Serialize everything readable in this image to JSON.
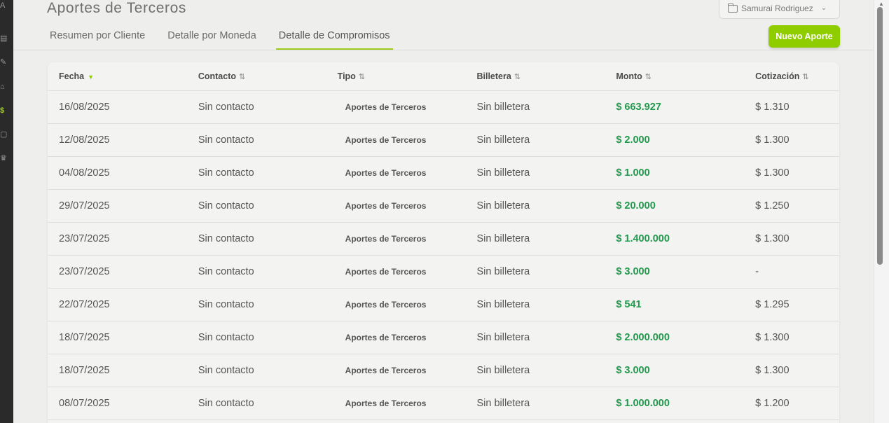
{
  "app": {
    "page_title": "Aportes de Terceros",
    "workspace_label": "Samurai Rodriguez",
    "new_button_label": "Nuevo Aporte",
    "accent_color": "#8fcc00",
    "amount_color": "#1f9a4c"
  },
  "rail": {
    "items": [
      {
        "icon": "logo-icon",
        "glyph": "A"
      },
      {
        "icon": "building-icon",
        "glyph": "▤"
      },
      {
        "icon": "pencil-icon",
        "glyph": "✎"
      },
      {
        "icon": "bell-icon",
        "glyph": "⌂"
      },
      {
        "icon": "dollar-icon",
        "glyph": "$"
      },
      {
        "icon": "card-icon",
        "glyph": "▢"
      },
      {
        "icon": "crown-icon",
        "glyph": "♛"
      }
    ]
  },
  "tabs": [
    {
      "label": "Resumen por Cliente",
      "active": false
    },
    {
      "label": "Detalle por Moneda",
      "active": false
    },
    {
      "label": "Detalle de Compromisos",
      "active": true
    }
  ],
  "table": {
    "columns": [
      {
        "label": "Fecha",
        "sort": "desc"
      },
      {
        "label": "Contacto",
        "sort": "both"
      },
      {
        "label": "Tipo",
        "sort": "both"
      },
      {
        "label": "Billetera",
        "sort": "both"
      },
      {
        "label": "Monto",
        "sort": "both"
      },
      {
        "label": "Cotización",
        "sort": "both"
      }
    ],
    "rows": [
      [
        "16/08/2025",
        "Sin contacto",
        "Aportes de Terceros",
        "Sin billetera",
        "$ 663.927",
        "$ 1.310"
      ],
      [
        "12/08/2025",
        "Sin contacto",
        "Aportes de Terceros",
        "Sin billetera",
        "$ 2.000",
        "$ 1.300"
      ],
      [
        "04/08/2025",
        "Sin contacto",
        "Aportes de Terceros",
        "Sin billetera",
        "$ 1.000",
        "$ 1.300"
      ],
      [
        "29/07/2025",
        "Sin contacto",
        "Aportes de Terceros",
        "Sin billetera",
        "$ 20.000",
        "$ 1.250"
      ],
      [
        "23/07/2025",
        "Sin contacto",
        "Aportes de Terceros",
        "Sin billetera",
        "$ 1.400.000",
        "$ 1.300"
      ],
      [
        "23/07/2025",
        "Sin contacto",
        "Aportes de Terceros",
        "Sin billetera",
        "$ 3.000",
        "-"
      ],
      [
        "22/07/2025",
        "Sin contacto",
        "Aportes de Terceros",
        "Sin billetera",
        "$ 541",
        "$ 1.295"
      ],
      [
        "18/07/2025",
        "Sin contacto",
        "Aportes de Terceros",
        "Sin billetera",
        "$ 2.000.000",
        "$ 1.300"
      ],
      [
        "18/07/2025",
        "Sin contacto",
        "Aportes de Terceros",
        "Sin billetera",
        "$ 3.000",
        "$ 1.300"
      ],
      [
        "08/07/2025",
        "Sin contacto",
        "Aportes de Terceros",
        "Sin billetera",
        "$ 1.000.000",
        "$ 1.200"
      ]
    ]
  }
}
